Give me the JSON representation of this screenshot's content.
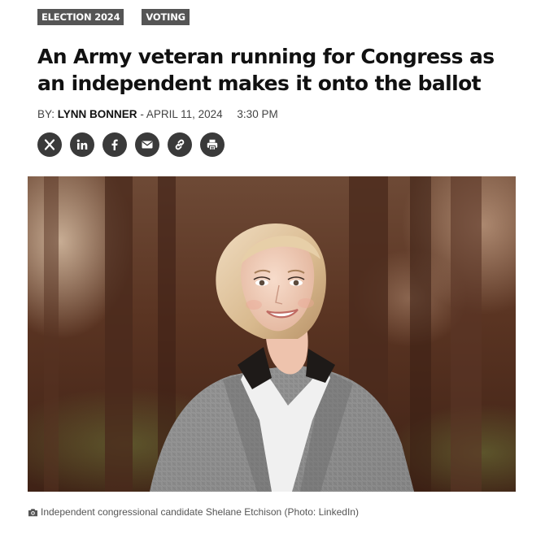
{
  "tags": [
    {
      "label": "ELECTION 2024"
    },
    {
      "label": "VOTING"
    }
  ],
  "headline": "An Army veteran running for Congress as an independent makes it onto the ballot",
  "byline": {
    "prefix": "BY:",
    "author": "LYNN BONNER",
    "separator": "-",
    "date": "APRIL 11, 2024",
    "time": "3:30 PM"
  },
  "share_icons": [
    "x-icon",
    "linkedin-icon",
    "facebook-icon",
    "email-icon",
    "link-icon",
    "print-icon"
  ],
  "photo": {
    "caption": "Independent congressional candidate Shelane Etchison (Photo: LinkedIn)",
    "caption_icon": "camera-icon"
  },
  "colors": {
    "tag_bg": "#555555",
    "icon_bg": "#3a3a3a",
    "text": "#111111",
    "meta_text": "#444444"
  }
}
